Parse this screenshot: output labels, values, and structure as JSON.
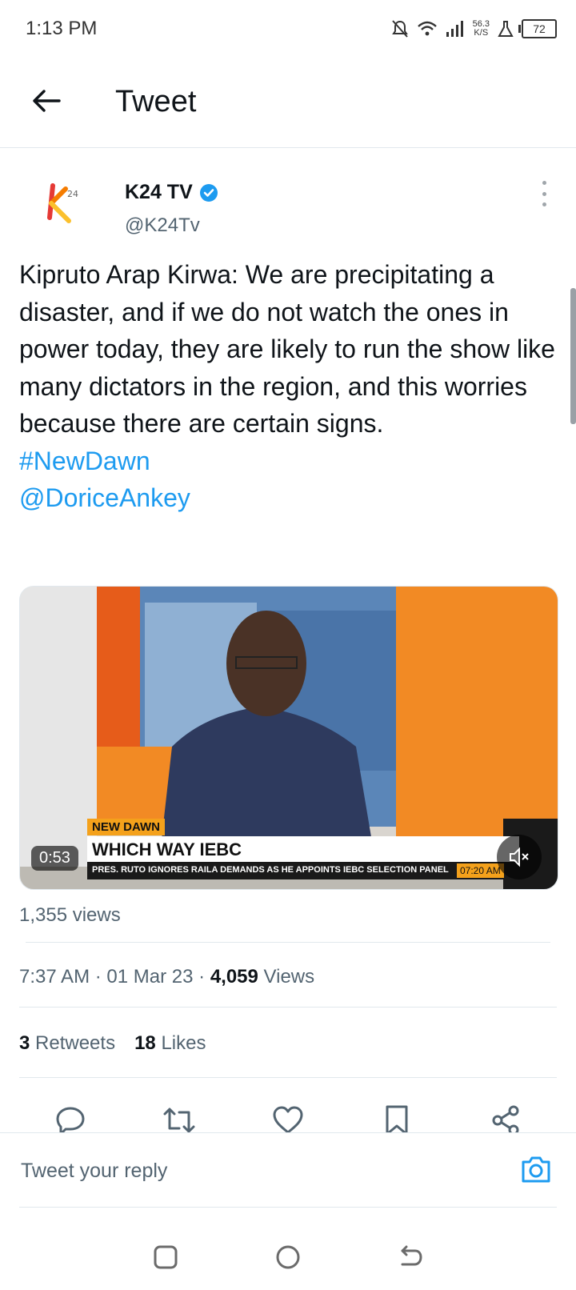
{
  "status_bar": {
    "time": "1:13 PM",
    "speed_value": "56.3",
    "speed_unit": "K/S",
    "battery": "72"
  },
  "header": {
    "title": "Tweet"
  },
  "tweet": {
    "author_name": "K24 TV",
    "author_handle": "@K24Tv",
    "text": "Kipruto Arap Kirwa: We are precipitating a disaster, and if we do not watch the ones in power today, they are likely to run the show like many dictators in the region, and this worries because there are certain signs.",
    "hashtag": "#NewDawn",
    "mention": "@DoriceAnkey",
    "media": {
      "duration": "0:53",
      "lower_third_tag": "NEW DAWN",
      "lower_third_title": "WHICH WAY IEBC",
      "ticker": "PRES. RUTO IGNORES RAILA DEMANDS AS HE APPOINTS IEBC SELECTION PANEL",
      "ticker_time": "07:20 AM"
    },
    "video_views": "1,355 views",
    "time": "7:37 AM",
    "date": "01 Mar 23",
    "separator": "·",
    "views_count": "4,059",
    "views_label": "Views",
    "retweets_count": "3",
    "retweets_label": "Retweets",
    "likes_count": "18",
    "likes_label": "Likes"
  },
  "reply": {
    "placeholder": "Tweet your reply"
  },
  "colors": {
    "accent": "#1d9bf0",
    "text": "#0f1419",
    "muted": "#536471",
    "divider": "#e1e8ed"
  },
  "icons": {
    "back": "arrow-left-icon",
    "verified": "verified-badge-icon",
    "more": "more-vertical-icon",
    "reply": "reply-icon",
    "retweet": "retweet-icon",
    "like": "heart-icon",
    "bookmark": "bookmark-icon",
    "share": "share-icon",
    "camera": "camera-icon",
    "mute": "mute-icon"
  }
}
